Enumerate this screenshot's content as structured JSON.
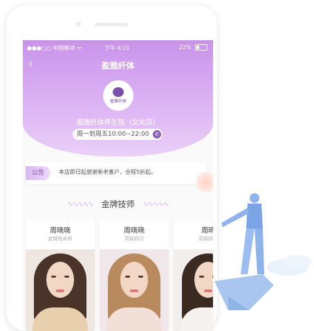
{
  "statusbar": {
    "carrier": "●●●○○ 中国移动 ᯤ",
    "time": "下午 4:21",
    "battery": "22%"
  },
  "header": {
    "back_icon": "‹",
    "title": "盈雅纤体"
  },
  "logo": {
    "text": "盈雅纤体"
  },
  "store": {
    "name": "盈雅纤体养生馆（文化店）",
    "hours": "周一到周五10:00~22:00",
    "phone_icon": "✆"
  },
  "notice": {
    "tag": "公告",
    "text": "本店即日起感谢新老客户，全程5折起。"
  },
  "section": {
    "title": "金牌技师",
    "wave": "∿∿∿∿∿"
  },
  "technicians": [
    {
      "name": "周晓晓",
      "role": "金牌技术师"
    },
    {
      "name": "周晓晓",
      "role": "高级顾问"
    },
    {
      "name": "周晓",
      "role": "高级顾问"
    }
  ],
  "colors": {
    "accent": "#c993ec",
    "brand": "#7b4ea8"
  }
}
